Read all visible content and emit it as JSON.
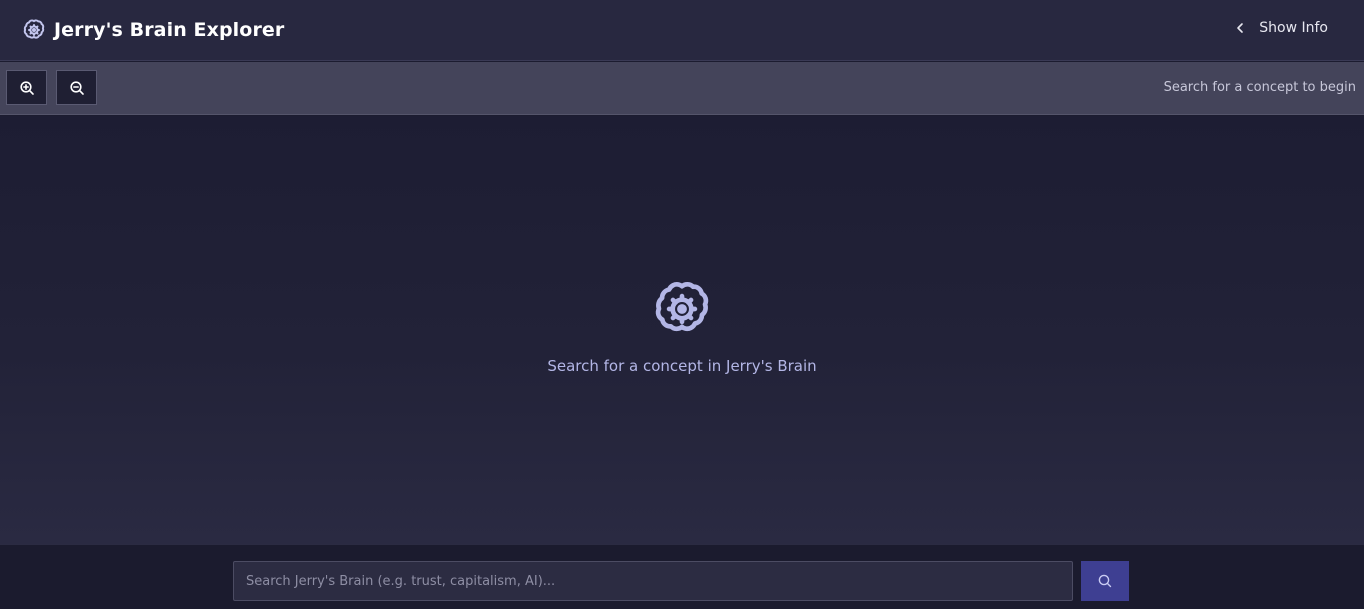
{
  "header": {
    "title": "Jerry's Brain Explorer",
    "show_info_label": "Show Info",
    "icon": "brain-icon"
  },
  "toolbar": {
    "zoom_in_icon": "zoom-in-icon",
    "zoom_out_icon": "zoom-out-icon",
    "status_text": "Search for a concept to begin"
  },
  "main": {
    "empty_icon": "brain-icon",
    "empty_message": "Search for a concept in Jerry's Brain"
  },
  "search": {
    "value": "",
    "placeholder": "Search Jerry's Brain (e.g. trust, capitalism, AI)...",
    "button_icon": "search-icon"
  },
  "colors": {
    "header_bg": "#282840",
    "toolbar_bg": "#44445a",
    "canvas_bg": "#1d1d33",
    "accent": "#3e3f92",
    "empty_icon_color": "#b3b6e6"
  }
}
